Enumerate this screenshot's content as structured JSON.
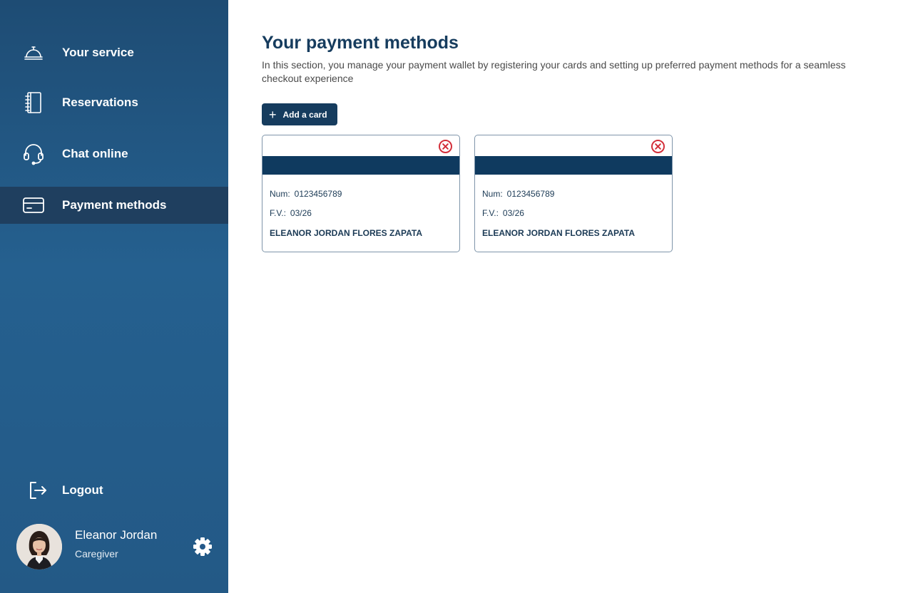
{
  "sidebar": {
    "nav": [
      {
        "label": "Your service",
        "icon": "service-bell-icon"
      },
      {
        "label": "Reservations",
        "icon": "notebook-icon"
      },
      {
        "label": "Chat online",
        "icon": "headset-icon"
      },
      {
        "label": "Payment methods",
        "icon": "credit-card-icon",
        "active": true
      }
    ],
    "logout_label": "Logout",
    "user": {
      "name": "Eleanor Jordan",
      "role": "Caregiver"
    }
  },
  "main": {
    "title": "Your payment methods",
    "description": "In this section, you manage your payment wallet by registering your cards and setting up preferred payment methods for a seamless checkout experience",
    "add_card_label": "Add a card",
    "cards": [
      {
        "num_label": "Num:",
        "num": "0123456789",
        "exp_label": "F.V.:",
        "exp": "03/26",
        "holder": "ELEANOR JORDAN FLORES ZAPATA"
      },
      {
        "num_label": "Num:",
        "num": "0123456789",
        "exp_label": "F.V.:",
        "exp": "03/26",
        "holder": "ELEANOR JORDAN FLORES ZAPATA"
      }
    ]
  },
  "colors": {
    "sidebar_top": "#1e4c74",
    "sidebar_mid": "#25608f",
    "active_item": "#1f3f5f",
    "primary": "#163c5e",
    "card_stripe": "#0f3a5f",
    "delete_red": "#d32f3a"
  }
}
